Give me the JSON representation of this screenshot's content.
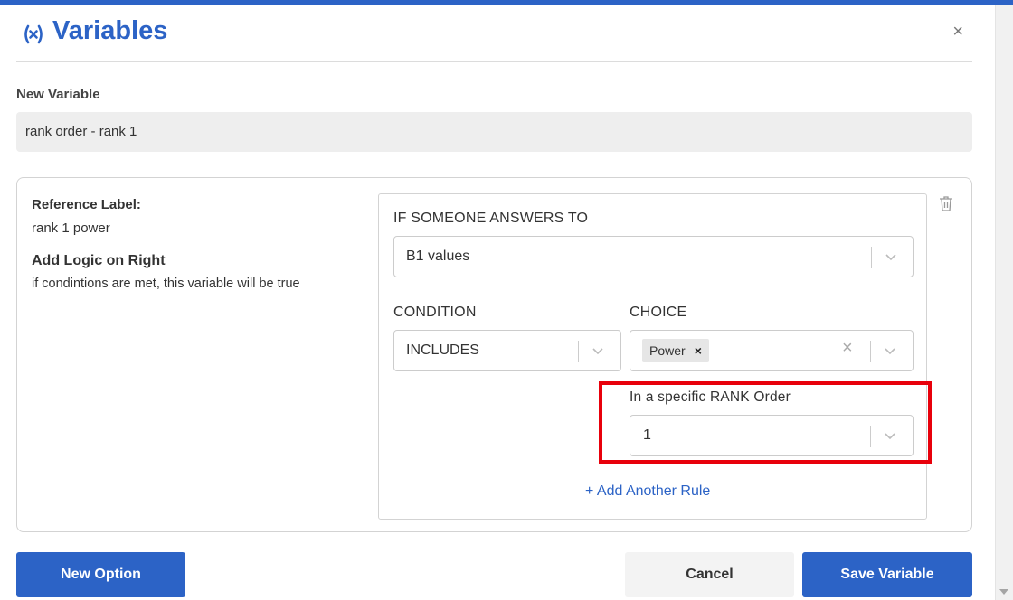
{
  "header": {
    "title": "Variables",
    "title_icon": "variable-icon",
    "close_icon": "close-icon",
    "close_glyph": "×"
  },
  "new_variable": {
    "label": "New Variable",
    "value": "rank order - rank 1"
  },
  "reference": {
    "label": "Reference Label:",
    "value": "rank 1 power",
    "logic_title": "Add Logic on Right",
    "logic_desc": "if condintions are met, this variable will be true"
  },
  "rule": {
    "if_label": "IF SOMEONE ANSWERS TO",
    "question_value": "B1 values",
    "condition_label": "CONDITION",
    "condition_value": "INCLUDES",
    "choice_label": "CHOICE",
    "choice_chip": "Power",
    "chip_remove_glyph": "×",
    "clear_glyph": "×",
    "rank_label": "In a specific RANK Order",
    "rank_value": "1",
    "add_rule": "+ Add Another Rule"
  },
  "footer": {
    "new_option": "New Option",
    "cancel": "Cancel",
    "save": "Save Variable"
  },
  "colors": {
    "accent": "#2c63c6",
    "highlight": "#e8000b",
    "input_bg": "#eeeeee"
  }
}
